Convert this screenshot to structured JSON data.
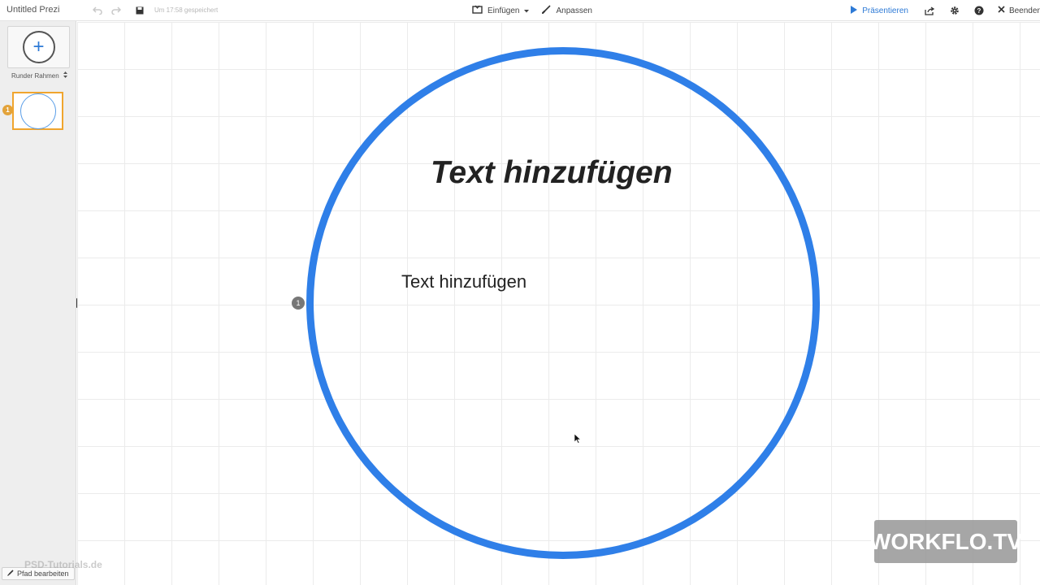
{
  "app": {
    "doc_title": "Untitled Prezi",
    "saved_status": "Um 17:58 gespeichert"
  },
  "toolbar": {
    "insert_label": "Einfügen",
    "customize_label": "Anpassen",
    "present_label": "Präsentieren",
    "end_label": "Beenden"
  },
  "sidebar": {
    "frame_type": "Runder Rahmen",
    "thumb_number": "1",
    "edit_path_label": "Pfad bearbeiten"
  },
  "canvas": {
    "path_badge": "1",
    "title_text": "Text hinzufügen",
    "body_text": "Text hinzufügen"
  },
  "watermark": {
    "logo": "WORKFLO.TV",
    "psd": "PSD-Tutorials.de"
  },
  "colors": {
    "accent": "#2f7fe8",
    "thumb_border": "#f0a52e"
  },
  "icons": [
    "undo-icon",
    "redo-icon",
    "save-icon",
    "insert-icon",
    "brush-icon",
    "play-icon",
    "share-icon",
    "gear-icon",
    "help-icon",
    "close-icon",
    "pencil-icon"
  ]
}
